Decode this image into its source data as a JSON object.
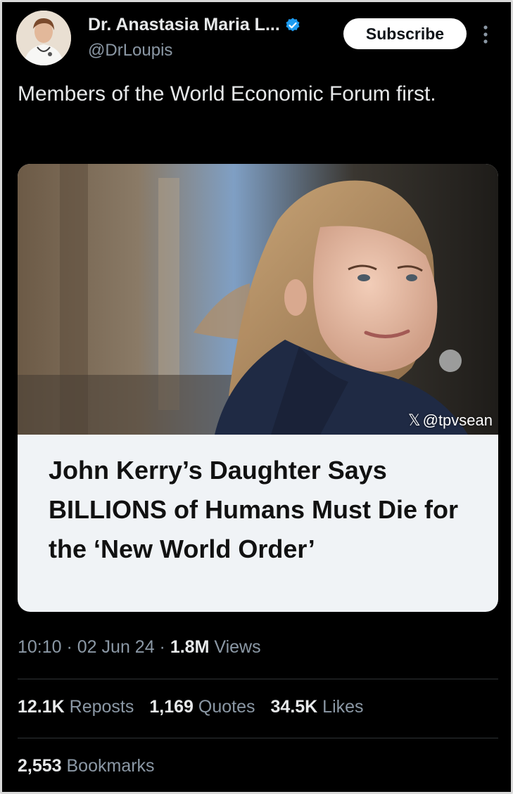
{
  "author": {
    "display_name": "Dr. Anastasia Maria L...",
    "handle": "@DrLoupis",
    "verified_color": "#1d9bf0"
  },
  "actions": {
    "subscribe_label": "Subscribe",
    "more_icon": "more-vertical-icon"
  },
  "tweet": {
    "text": "Members of the World Economic Forum first."
  },
  "media": {
    "watermark_x": "𝕏",
    "watermark_handle": "@tpvsean",
    "headline": "John Kerry’s Daughter Says BILLIONS of Humans Must Die for the ‘New World Order’"
  },
  "meta": {
    "time": "10:10",
    "sep1": " · ",
    "date": "02 Jun 24",
    "sep2": " · ",
    "views_count": "1.8M",
    "views_label": " Views"
  },
  "stats": {
    "reposts_count": "12.1K",
    "reposts_label": " Reposts",
    "quotes_count": "1,169",
    "quotes_label": " Quotes",
    "likes_count": "34.5K",
    "likes_label": " Likes",
    "bookmarks_count": "2,553",
    "bookmarks_label": " Bookmarks"
  }
}
